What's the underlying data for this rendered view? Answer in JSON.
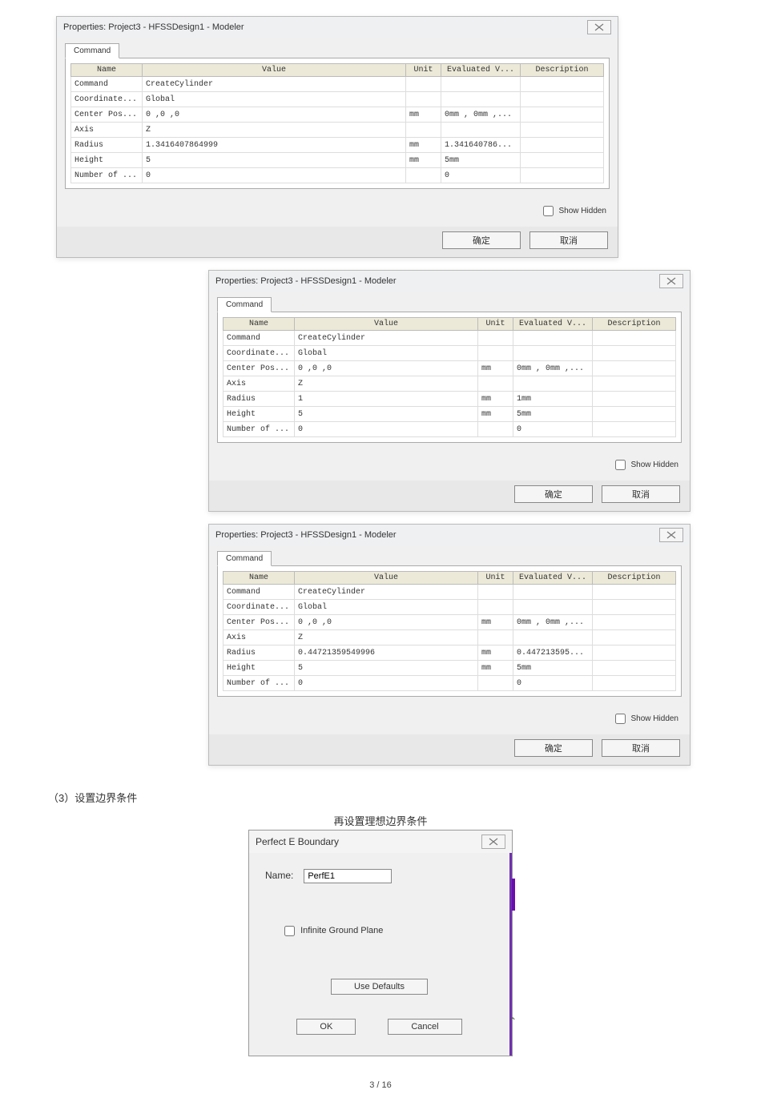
{
  "dialog1": {
    "title": "Properties: Project3 - HFSSDesign1 - Modeler",
    "tab": "Command",
    "headers": {
      "name": "Name",
      "value": "Value",
      "unit": "Unit",
      "eval": "Evaluated V...",
      "desc": "Description"
    },
    "rows": [
      {
        "name": "Command",
        "value": "CreateCylinder",
        "unit": "",
        "eval": "",
        "desc": ""
      },
      {
        "name": "Coordinate...",
        "value": "Global",
        "unit": "",
        "eval": "",
        "desc": ""
      },
      {
        "name": "Center Pos...",
        "value": "0 ,0 ,0",
        "unit": "mm",
        "eval": "0mm , 0mm ,...",
        "desc": ""
      },
      {
        "name": "Axis",
        "value": "Z",
        "unit": "",
        "eval": "",
        "desc": ""
      },
      {
        "name": "Radius",
        "value": "1.3416407864999",
        "unit": "mm",
        "eval": "1.341640786...",
        "desc": ""
      },
      {
        "name": "Height",
        "value": "5",
        "unit": "mm",
        "eval": "5mm",
        "desc": ""
      },
      {
        "name": "Number of ...",
        "value": "0",
        "unit": "",
        "eval": "0",
        "desc": ""
      }
    ],
    "showHidden": "Show Hidden",
    "ok": "确定",
    "cancel": "取消"
  },
  "dialog2": {
    "title": "Properties: Project3 - HFSSDesign1 - Modeler",
    "tab": "Command",
    "rows": [
      {
        "name": "Command",
        "value": "CreateCylinder",
        "unit": "",
        "eval": "",
        "desc": ""
      },
      {
        "name": "Coordinate...",
        "value": "Global",
        "unit": "",
        "eval": "",
        "desc": ""
      },
      {
        "name": "Center Pos...",
        "value": "0 ,0 ,0",
        "unit": "mm",
        "eval": "0mm , 0mm ,...",
        "desc": ""
      },
      {
        "name": "Axis",
        "value": "Z",
        "unit": "",
        "eval": "",
        "desc": ""
      },
      {
        "name": "Radius",
        "value": "1",
        "unit": "mm",
        "eval": "1mm",
        "desc": ""
      },
      {
        "name": "Height",
        "value": "5",
        "unit": "mm",
        "eval": "5mm",
        "desc": ""
      },
      {
        "name": "Number of ...",
        "value": "0",
        "unit": "",
        "eval": "0",
        "desc": ""
      }
    ],
    "showHidden": "Show Hidden",
    "ok": "确定",
    "cancel": "取消"
  },
  "dialog3": {
    "title": "Properties: Project3 - HFSSDesign1 - Modeler",
    "tab": "Command",
    "rows": [
      {
        "name": "Command",
        "value": "CreateCylinder",
        "unit": "",
        "eval": "",
        "desc": ""
      },
      {
        "name": "Coordinate...",
        "value": "Global",
        "unit": "",
        "eval": "",
        "desc": ""
      },
      {
        "name": "Center Pos...",
        "value": "0 ,0 ,0",
        "unit": "mm",
        "eval": "0mm , 0mm ,...",
        "desc": ""
      },
      {
        "name": "Axis",
        "value": "Z",
        "unit": "",
        "eval": "",
        "desc": ""
      },
      {
        "name": "Radius",
        "value": "0.44721359549996",
        "unit": "mm",
        "eval": "0.447213595...",
        "desc": ""
      },
      {
        "name": "Height",
        "value": "5",
        "unit": "mm",
        "eval": "5mm",
        "desc": ""
      },
      {
        "name": "Number of ...",
        "value": "0",
        "unit": "",
        "eval": "0",
        "desc": ""
      }
    ],
    "showHidden": "Show Hidden",
    "ok": "确定",
    "cancel": "取消"
  },
  "section3": "（3）设置边界条件",
  "peCaption": "再设置理想边界条件",
  "pe": {
    "title": "Perfect E Boundary",
    "nameLabel": "Name:",
    "nameValue": "PerfE1",
    "infGround": "Infinite Ground Plane",
    "useDefaults": "Use Defaults",
    "ok": "OK",
    "cancel": "Cancel"
  },
  "pagenum": "3 / 16"
}
